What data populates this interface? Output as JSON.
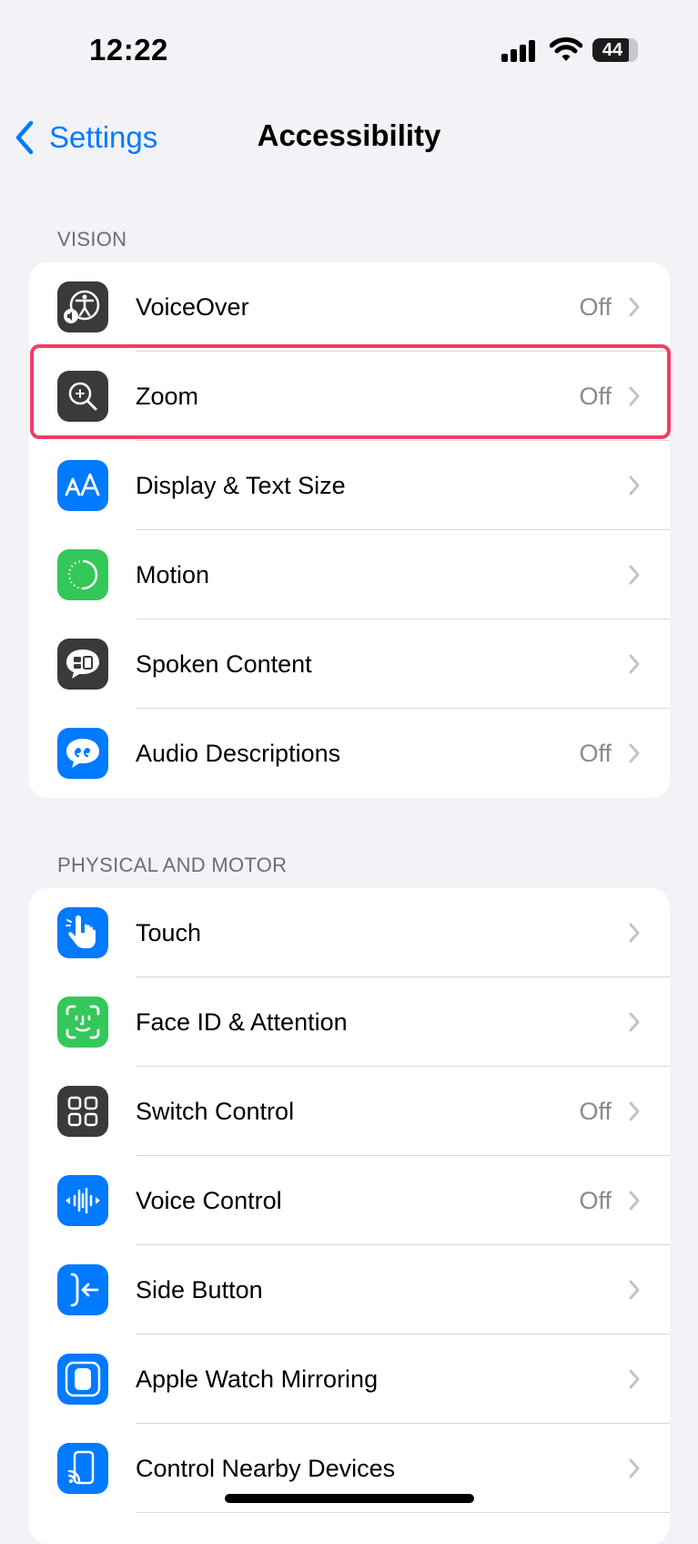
{
  "status_bar": {
    "time": "12:22",
    "battery_level": "44"
  },
  "nav": {
    "back_label": "Settings",
    "title": "Accessibility"
  },
  "sections": [
    {
      "header": "VISION",
      "rows": [
        {
          "label": "VoiceOver",
          "value": "Off",
          "icon": "voiceover-icon",
          "icon_color": "#3a3a3c"
        },
        {
          "label": "Zoom",
          "value": "Off",
          "icon": "zoom-icon",
          "icon_color": "#3a3a3c",
          "highlighted": true
        },
        {
          "label": "Display & Text Size",
          "value": "",
          "icon": "text-size-icon",
          "icon_color": "#007aff"
        },
        {
          "label": "Motion",
          "value": "",
          "icon": "motion-icon",
          "icon_color": "#34c759"
        },
        {
          "label": "Spoken Content",
          "value": "",
          "icon": "spoken-content-icon",
          "icon_color": "#3a3a3c"
        },
        {
          "label": "Audio Descriptions",
          "value": "Off",
          "icon": "audio-descriptions-icon",
          "icon_color": "#007aff"
        }
      ]
    },
    {
      "header": "PHYSICAL AND MOTOR",
      "rows": [
        {
          "label": "Touch",
          "value": "",
          "icon": "touch-icon",
          "icon_color": "#007aff"
        },
        {
          "label": "Face ID & Attention",
          "value": "",
          "icon": "face-id-icon",
          "icon_color": "#34c759"
        },
        {
          "label": "Switch Control",
          "value": "Off",
          "icon": "switch-control-icon",
          "icon_color": "#3a3a3c"
        },
        {
          "label": "Voice Control",
          "value": "Off",
          "icon": "voice-control-icon",
          "icon_color": "#007aff"
        },
        {
          "label": "Side Button",
          "value": "",
          "icon": "side-button-icon",
          "icon_color": "#007aff"
        },
        {
          "label": "Apple Watch Mirroring",
          "value": "",
          "icon": "watch-mirroring-icon",
          "icon_color": "#007aff"
        },
        {
          "label": "Control Nearby Devices",
          "value": "",
          "icon": "nearby-devices-icon",
          "icon_color": "#007aff"
        }
      ]
    }
  ],
  "colors": {
    "accent": "#007aff",
    "highlight": "#f23d64",
    "background": "#f2f2f7"
  }
}
